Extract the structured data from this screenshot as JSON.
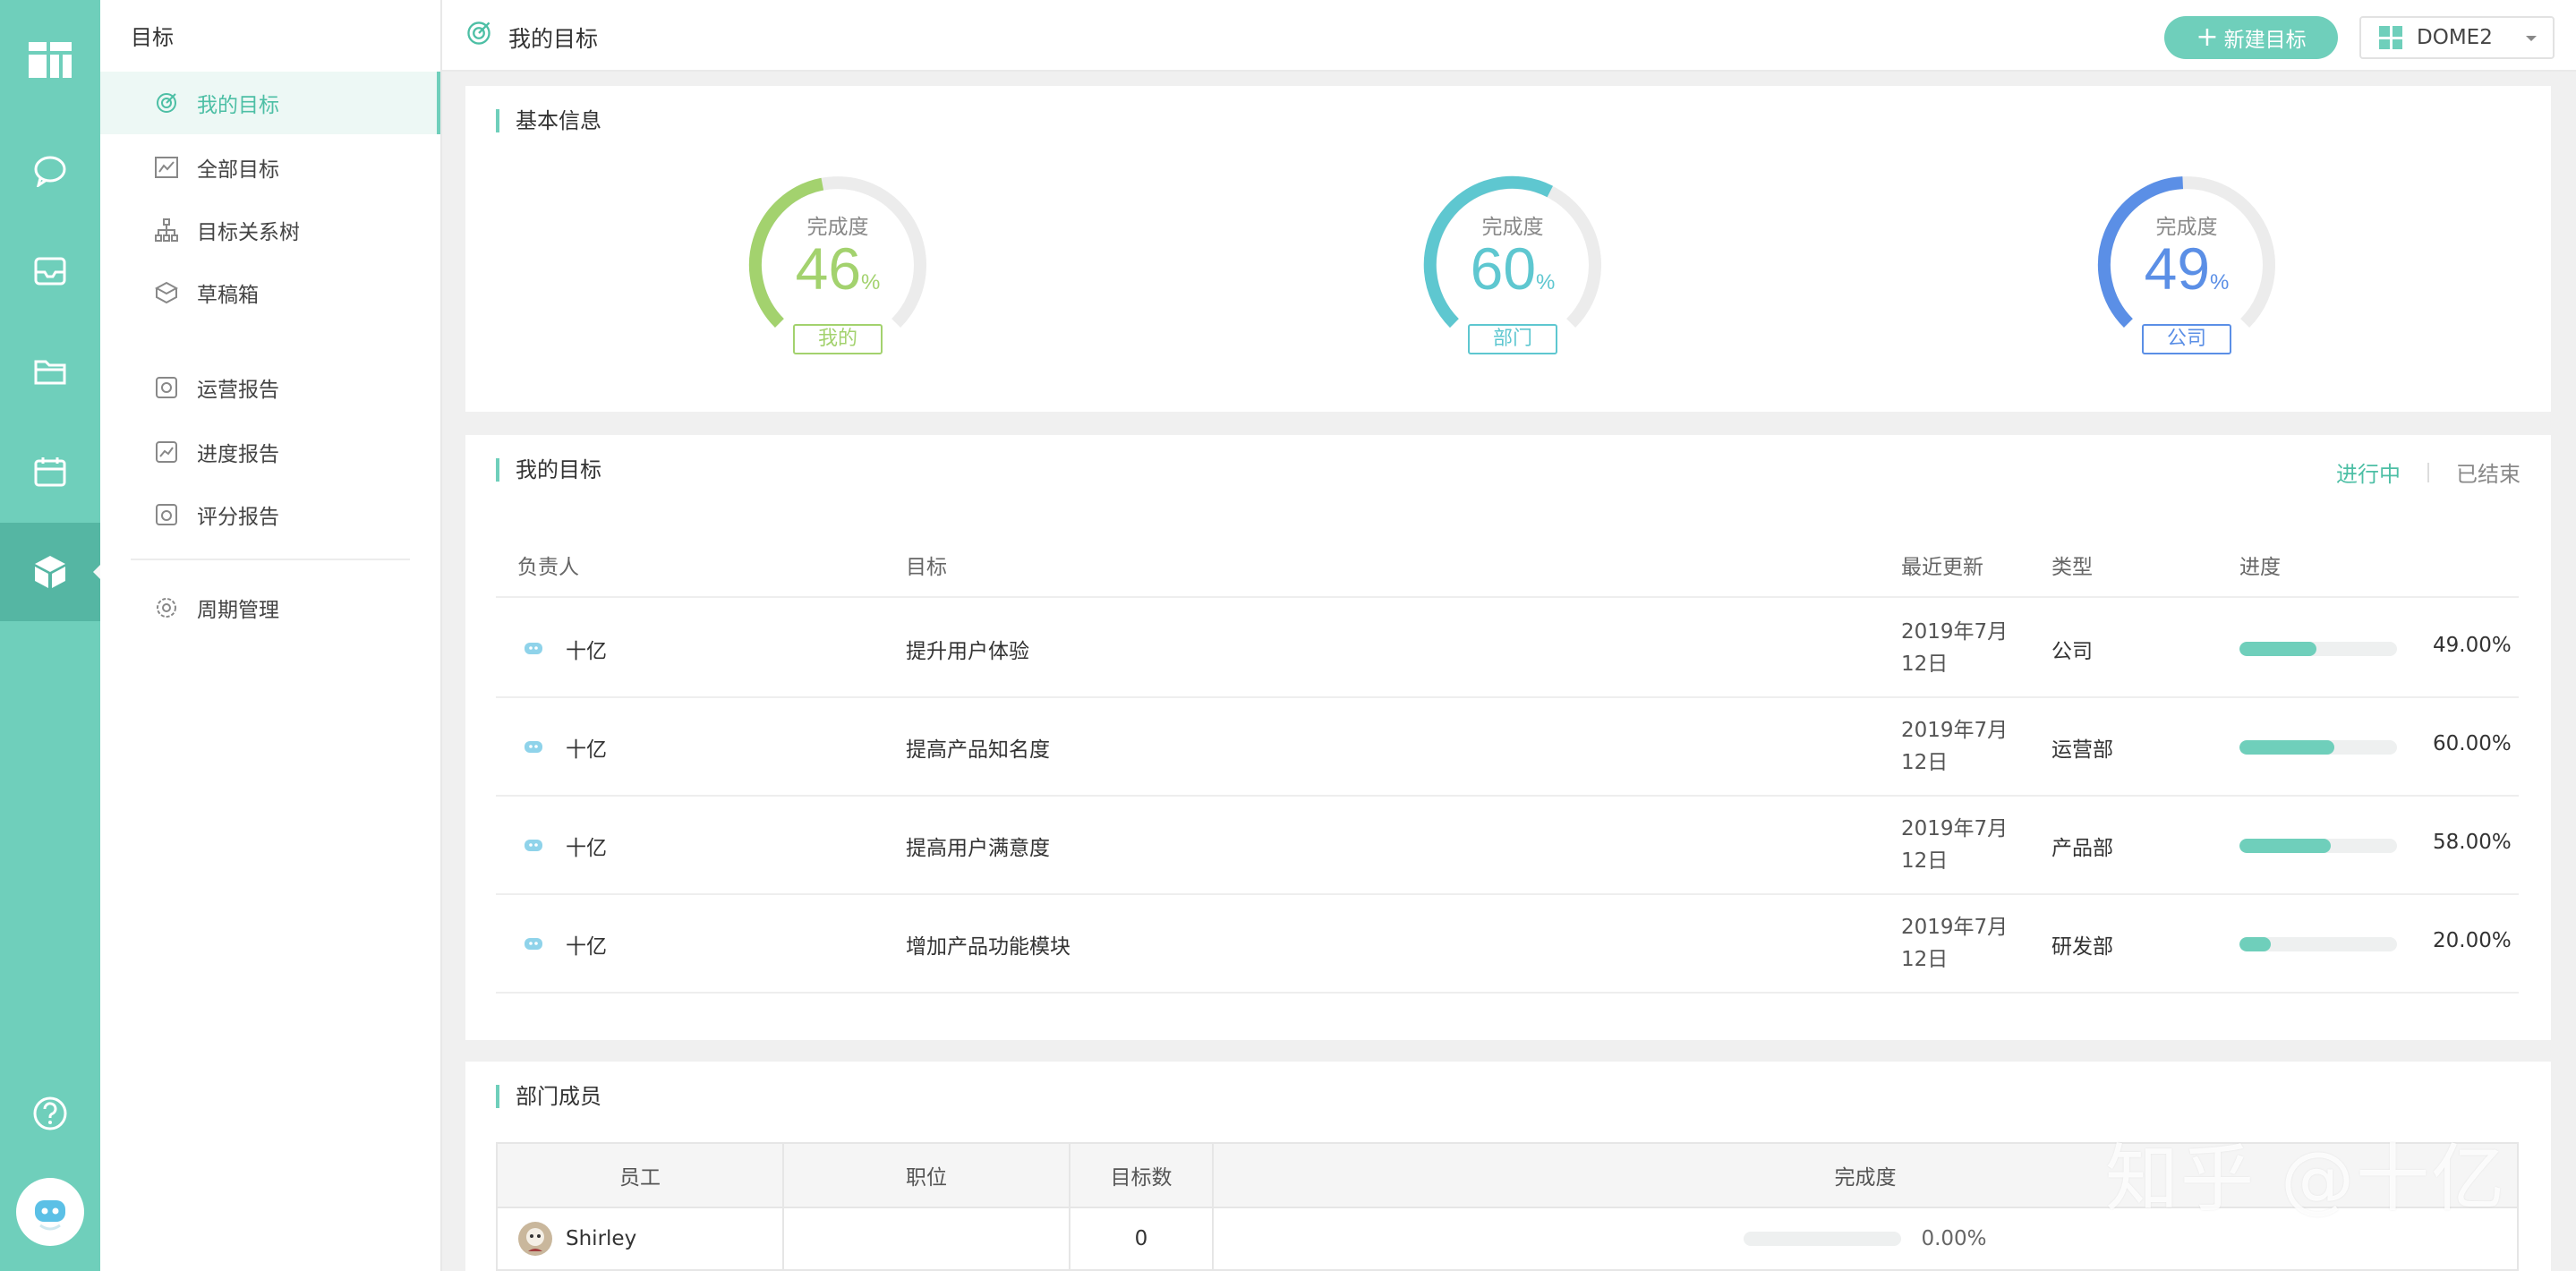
{
  "sidebar": {
    "title": "目标",
    "items": [
      {
        "label": "我的目标"
      },
      {
        "label": "全部目标"
      },
      {
        "label": "目标关系树"
      },
      {
        "label": "草稿箱"
      },
      {
        "label": "运营报告"
      },
      {
        "label": "进度报告"
      },
      {
        "label": "评分报告"
      },
      {
        "label": "周期管理"
      }
    ]
  },
  "topbar": {
    "title": "我的目标",
    "new_button": "新建目标",
    "org": "DOME2"
  },
  "basic_info": {
    "title": "基本信息",
    "gauges": [
      {
        "label": "完成度",
        "value": "46",
        "unit": "%",
        "tag": "我的",
        "percent": 46,
        "color": "#a3d26e"
      },
      {
        "label": "完成度",
        "value": "60",
        "unit": "%",
        "tag": "部门",
        "percent": 60,
        "color": "#5ec7d0"
      },
      {
        "label": "完成度",
        "value": "49",
        "unit": "%",
        "tag": "公司",
        "percent": 49,
        "color": "#5b8fe6"
      }
    ]
  },
  "goals": {
    "title": "我的目标",
    "tabs": [
      "进行中",
      "已结束"
    ],
    "columns": [
      "负责人",
      "目标",
      "最近更新",
      "类型",
      "进度"
    ],
    "rows": [
      {
        "owner": "十亿",
        "goal": "提升用户体验",
        "date1": "2019年7月",
        "date2": "12日",
        "type": "公司",
        "progress": 49,
        "progress_text": "49.00%"
      },
      {
        "owner": "十亿",
        "goal": "提高产品知名度",
        "date1": "2019年7月",
        "date2": "12日",
        "type": "运营部",
        "progress": 60,
        "progress_text": "60.00%"
      },
      {
        "owner": "十亿",
        "goal": "提高用户满意度",
        "date1": "2019年7月",
        "date2": "12日",
        "type": "产品部",
        "progress": 58,
        "progress_text": "58.00%"
      },
      {
        "owner": "十亿",
        "goal": "增加产品功能模块",
        "date1": "2019年7月",
        "date2": "12日",
        "type": "研发部",
        "progress": 20,
        "progress_text": "20.00%"
      }
    ]
  },
  "members": {
    "title": "部门成员",
    "columns": [
      "员工",
      "职位",
      "目标数",
      "完成度"
    ],
    "rows": [
      {
        "name": "Shirley",
        "position": "",
        "goal_count": "0",
        "progress": 0,
        "progress_text": "0.00%"
      }
    ]
  },
  "watermark": "知乎 @十亿",
  "colors": {
    "accent": "#6fcfbb",
    "rail": "#6fcfbb",
    "rail_active": "#55b6a3"
  }
}
